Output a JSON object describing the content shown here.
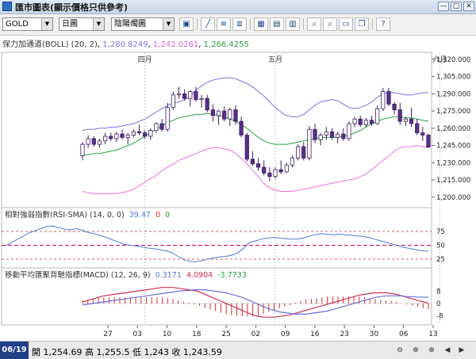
{
  "window": {
    "title": "匯市圖表(顯示價格只供參考)",
    "buttons": [
      "—",
      "□",
      "✕"
    ]
  },
  "toolbar": {
    "symbol": "GOLD",
    "period": "日圖",
    "chart_style": "陰陽燭圖"
  },
  "indicators": {
    "boll": {
      "label": "保力加通道(BOLL) (20, 2)",
      "upper": "1,280.8249",
      "lower": "1,242.0261",
      "mid": "1,266.4255"
    },
    "rsi": {
      "label": "相對強弱指數(RSI-SMA) (14, 0, 0)",
      "v1": "39.47",
      "v2": "0",
      "v3": "0"
    },
    "macd": {
      "label": "移動平均匯聚背馳指標(MACD) (12, 26, 9)",
      "v1": "0.3171",
      "v2": "4.0904",
      "v3": "-3.7733"
    }
  },
  "status": {
    "date": "06/19",
    "quote": "開 1,254.69 高 1,255.5 低 1,243 收 1,243.59"
  },
  "colors": {
    "up": "#ffffff",
    "down": "#5a2d8c",
    "boll_upper": "#7f6fe0",
    "boll_mid": "#28a040",
    "boll_lower": "#f070e0",
    "rsi": "#4a7bd4",
    "rsi_level_hi": "#d06060",
    "rsi_level_mid": "#c00060",
    "macd_line": "#d03050",
    "signal_line": "#6b6fd8",
    "hist": "#d03030"
  },
  "chart_data": [
    {
      "type": "candlestick",
      "title": "",
      "month_labels": [
        {
          "label": "四月",
          "index": 11
        },
        {
          "label": "五月",
          "index": 34
        },
        {
          "label": "六月",
          "index": 63
        }
      ],
      "y_ticks": [
        1200,
        1215,
        1230,
        1245,
        1260,
        1275,
        1290,
        1305,
        1320
      ],
      "y_tick_labels": [
        "1,200.000",
        "1,215.000",
        "1,230.000",
        "1,245.000",
        "1,260.000",
        "1,275.000",
        "1,290.000",
        "1,305.000",
        "1,320.000"
      ],
      "ylim": [
        1195,
        1322
      ],
      "ohlc": [
        [
          1236,
          1248,
          1232,
          1246
        ],
        [
          1246,
          1254,
          1243,
          1251
        ],
        [
          1251,
          1253,
          1244,
          1246
        ],
        [
          1246,
          1251,
          1243,
          1249
        ],
        [
          1249,
          1256,
          1246,
          1253
        ],
        [
          1253,
          1256,
          1249,
          1251
        ],
        [
          1251,
          1257,
          1248,
          1255
        ],
        [
          1255,
          1259,
          1250,
          1252
        ],
        [
          1252,
          1256,
          1246,
          1254
        ],
        [
          1254,
          1259,
          1252,
          1257
        ],
        [
          1257,
          1263,
          1254,
          1256
        ],
        [
          1256,
          1258,
          1251,
          1253
        ],
        [
          1253,
          1260,
          1250,
          1258
        ],
        [
          1258,
          1265,
          1256,
          1264
        ],
        [
          1264,
          1268,
          1257,
          1259
        ],
        [
          1259,
          1282,
          1257,
          1278
        ],
        [
          1278,
          1292,
          1276,
          1289
        ],
        [
          1289,
          1296,
          1286,
          1290
        ],
        [
          1290,
          1294,
          1284,
          1286
        ],
        [
          1286,
          1293,
          1279,
          1292
        ],
        [
          1292,
          1296,
          1283,
          1285
        ],
        [
          1285,
          1289,
          1278,
          1286
        ],
        [
          1286,
          1289,
          1274,
          1276
        ],
        [
          1276,
          1281,
          1266,
          1271
        ],
        [
          1271,
          1276,
          1263,
          1275
        ],
        [
          1275,
          1279,
          1266,
          1268
        ],
        [
          1268,
          1278,
          1262,
          1276
        ],
        [
          1276,
          1280,
          1263,
          1266
        ],
        [
          1266,
          1270,
          1252,
          1254
        ],
        [
          1254,
          1256,
          1231,
          1233
        ],
        [
          1233,
          1240,
          1227,
          1229
        ],
        [
          1229,
          1234,
          1223,
          1226
        ],
        [
          1226,
          1232,
          1219,
          1221
        ],
        [
          1221,
          1226,
          1214,
          1218
        ],
        [
          1218,
          1226,
          1216,
          1224
        ],
        [
          1224,
          1232,
          1220,
          1222
        ],
        [
          1222,
          1230,
          1221,
          1228
        ],
        [
          1228,
          1236,
          1226,
          1234
        ],
        [
          1234,
          1246,
          1232,
          1244
        ],
        [
          1244,
          1248,
          1232,
          1234
        ],
        [
          1234,
          1262,
          1232,
          1259
        ],
        [
          1259,
          1264,
          1247,
          1250
        ],
        [
          1250,
          1256,
          1245,
          1254
        ],
        [
          1254,
          1261,
          1250,
          1257
        ],
        [
          1257,
          1260,
          1250,
          1252
        ],
        [
          1252,
          1257,
          1247,
          1255
        ],
        [
          1255,
          1260,
          1249,
          1251
        ],
        [
          1251,
          1266,
          1249,
          1264
        ],
        [
          1264,
          1270,
          1261,
          1268
        ],
        [
          1268,
          1271,
          1261,
          1263
        ],
        [
          1263,
          1269,
          1261,
          1267
        ],
        [
          1267,
          1271,
          1262,
          1264
        ],
        [
          1264,
          1280,
          1263,
          1277
        ],
        [
          1277,
          1295,
          1275,
          1292
        ],
        [
          1292,
          1295,
          1279,
          1281
        ],
        [
          1281,
          1283,
          1272,
          1276
        ],
        [
          1276,
          1282,
          1263,
          1266
        ],
        [
          1266,
          1270,
          1262,
          1268
        ],
        [
          1268,
          1278,
          1261,
          1264
        ],
        [
          1264,
          1268,
          1254,
          1256
        ],
        [
          1256,
          1261,
          1249,
          1254
        ],
        [
          1254,
          1255.5,
          1243,
          1243.59
        ]
      ],
      "boll_upper": [
        1258,
        1259,
        1259,
        1260,
        1260,
        1261,
        1261,
        1262,
        1263,
        1264,
        1266,
        1268,
        1271,
        1274,
        1277,
        1280,
        1282,
        1283,
        1285,
        1288,
        1293,
        1297,
        1300,
        1302,
        1303,
        1304,
        1304,
        1303,
        1301,
        1299,
        1296,
        1292,
        1288,
        1283,
        1278,
        1274,
        1271,
        1270,
        1270,
        1272,
        1276,
        1280,
        1283,
        1284,
        1285,
        1284,
        1281,
        1278,
        1277,
        1278,
        1280,
        1283,
        1287,
        1290,
        1291,
        1291,
        1290,
        1289,
        1289,
        1290,
        1291,
        1291
      ],
      "boll_mid": [
        1237,
        1237,
        1238,
        1238,
        1239,
        1240,
        1241,
        1243,
        1245,
        1247,
        1250,
        1253,
        1256,
        1259,
        1262,
        1265,
        1267,
        1269,
        1270,
        1271,
        1272,
        1272,
        1273,
        1272,
        1271,
        1270,
        1268,
        1266,
        1263,
        1260,
        1256,
        1252,
        1249,
        1247,
        1246,
        1246,
        1246,
        1247,
        1248,
        1249,
        1250,
        1251,
        1252,
        1252,
        1252,
        1252,
        1253,
        1254,
        1256,
        1258,
        1261,
        1264,
        1266,
        1268,
        1269,
        1270,
        1270,
        1269,
        1269,
        1268,
        1267,
        1266
      ],
      "boll_lower": [
        1205,
        1204,
        1203,
        1203,
        1203,
        1203,
        1203,
        1204,
        1205,
        1207,
        1210,
        1213,
        1216,
        1219,
        1223,
        1226,
        1229,
        1232,
        1234,
        1236,
        1238,
        1240,
        1242,
        1243,
        1243,
        1242,
        1241,
        1238,
        1234,
        1229,
        1223,
        1218,
        1212,
        1208,
        1206,
        1205,
        1205,
        1205,
        1206,
        1207,
        1208,
        1209,
        1210,
        1211,
        1212,
        1213,
        1214,
        1215,
        1216,
        1218,
        1220,
        1224,
        1228,
        1232,
        1236,
        1240,
        1243,
        1244,
        1244,
        1245,
        1244,
        1243
      ]
    },
    {
      "type": "line",
      "title": "相對強弱指數(RSI-SMA)",
      "y_tick_labels": [
        "25",
        "50",
        "75"
      ],
      "levels": [
        25,
        50,
        75
      ],
      "ylim": [
        15,
        95
      ],
      "values": [
        49,
        54,
        60,
        66,
        72,
        76,
        80,
        84,
        85,
        82,
        79,
        78,
        80,
        77,
        73,
        71,
        68,
        64,
        60,
        56,
        52,
        50,
        49,
        47,
        45,
        44,
        42,
        40,
        37,
        30,
        24,
        21,
        20,
        22,
        25,
        27,
        29,
        30,
        32,
        36,
        44,
        55,
        58,
        61,
        63,
        64,
        63,
        62,
        61,
        61,
        63,
        66,
        69,
        71,
        70,
        69,
        70,
        69,
        68,
        67,
        66,
        64,
        61,
        58,
        55,
        52,
        49,
        46,
        44,
        42,
        40,
        39.47
      ]
    },
    {
      "type": "line",
      "title": "移動平均匯聚背馳指標(MACD)",
      "y_tick_labels": [
        "-8",
        "0",
        "8"
      ],
      "ylim": [
        -12,
        14
      ],
      "x_tick_labels": [
        "27",
        "03",
        "10",
        "18",
        "25",
        "02",
        "09",
        "16",
        "23",
        "30",
        "06",
        "13"
      ],
      "macd": [
        1,
        2,
        3,
        4,
        5,
        5.5,
        6,
        6.5,
        7,
        7.5,
        8,
        8.5,
        9,
        9.5,
        10,
        10.5,
        10.5,
        10.5,
        10,
        9.5,
        9,
        8.5,
        7.5,
        6,
        4.5,
        3,
        1.5,
        0,
        -1.5,
        -3,
        -4.5,
        -6,
        -7.5,
        -8.5,
        -9,
        -9,
        -9,
        -8.5,
        -8,
        -7.5,
        -6.5,
        -5.5,
        -4.5,
        -3.5,
        -2.5,
        -1.5,
        -0.5,
        0.5,
        1.5,
        2.5,
        3.5,
        4.5,
        5.5,
        6,
        6.5,
        7,
        7,
        7,
        6.5,
        6,
        5,
        4,
        3,
        2,
        1,
        0.3171
      ],
      "signal": [
        -1,
        -0.5,
        0,
        0.5,
        1,
        1.5,
        2,
        2.5,
        3,
        3.5,
        4,
        4.5,
        5,
        5.5,
        6,
        6.5,
        7,
        7.5,
        8,
        8.5,
        8.5,
        9,
        9,
        9,
        8.5,
        8,
        7.5,
        7,
        6,
        5,
        4,
        2.5,
        1,
        -0.5,
        -2,
        -3.5,
        -4.5,
        -5.5,
        -6,
        -6.5,
        -7,
        -7,
        -7,
        -6.5,
        -6,
        -5.5,
        -5,
        -4,
        -3,
        -2,
        -1,
        0,
        1,
        2,
        3,
        4,
        4.5,
        5,
        5,
        5,
        5,
        4.5,
        4.5,
        4.2,
        4.1,
        4.0904
      ],
      "histogram": [
        2,
        2.5,
        3,
        3.5,
        4,
        4,
        4,
        4,
        4,
        4,
        4,
        4,
        4,
        4,
        4,
        4,
        3.5,
        3,
        2,
        1,
        0.5,
        -0.5,
        -1.5,
        -3,
        -4,
        -5,
        -6,
        -7,
        -7.5,
        -8,
        -8.5,
        -8.5,
        -8.5,
        -8,
        -7,
        -5.5,
        -4.5,
        -3,
        -2,
        -1,
        0.5,
        1.5,
        2.5,
        3,
        3.5,
        4,
        4.5,
        4.5,
        4.5,
        4.5,
        4.5,
        4.5,
        4.5,
        4,
        3.5,
        3,
        2.5,
        2,
        1.5,
        1,
        0,
        -0.5,
        -1.5,
        -2.2,
        -3.1,
        -3.7733
      ]
    }
  ]
}
